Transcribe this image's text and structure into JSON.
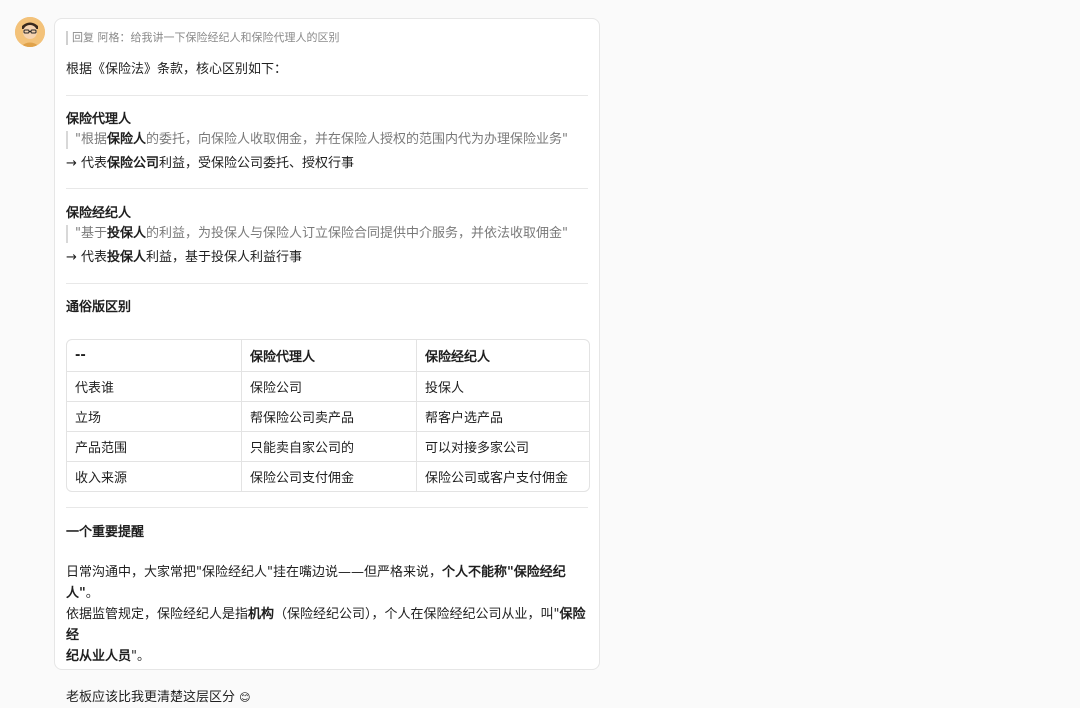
{
  "avatar": {
    "alt": "user-avatar",
    "bg": "#f3c27a"
  },
  "message": {
    "reply_header": "回复 阿格：给我讲一下保险经纪人和保险代理人的区别",
    "intro": "根据《保险法》条款，核心区别如下：",
    "agent": {
      "title": "保险代理人",
      "quote_pre": "\"根据",
      "quote_bold": "保险人",
      "quote_post": "的委托，向保险人收取佣金，并在保险人授权的范围内代为办理保险业务\"",
      "summary_pre": "→ 代表",
      "summary_bold": "保险公司",
      "summary_post": "利益，受保险公司委托、授权行事"
    },
    "broker": {
      "title": "保险经纪人",
      "quote_pre": "\"基于",
      "quote_bold": "投保人",
      "quote_post": "的利益，为投保人与保险人订立保险合同提供中介服务，并依法收取佣金\"",
      "summary_pre": "→ 代表",
      "summary_bold": "投保人",
      "summary_post": "利益，基于投保人利益行事"
    },
    "table_title": "通俗版区别",
    "table": {
      "headers": [
        "--",
        "保险代理人",
        "保险经纪人"
      ],
      "rows": [
        [
          "代表谁",
          "保险公司",
          "投保人"
        ],
        [
          "立场",
          "帮保险公司卖产品",
          "帮客户选产品"
        ],
        [
          "产品范围",
          "只能卖自家公司的",
          "可以对接多家公司"
        ],
        [
          "收入来源",
          "保险公司支付佣金",
          "保险公司或客户支付佣金"
        ]
      ]
    },
    "reminder": {
      "title": "一个重要提醒",
      "p1_a": "日常沟通中，大家常把\"保险经纪人\"挂在嘴边说——但严格来说，",
      "p1_b": "个人不能称\"保险经纪人\"",
      "p1_c": "。",
      "p2_a": "依据监管规定，保险经纪人是指",
      "p2_b": "机构",
      "p2_c": "（保险经纪公司），个人在保险经纪公司从业，叫\"",
      "p2_d": "保险经",
      "p2_e": "纪从业人员",
      "p2_f": "\"。"
    },
    "closing": "老板应该比我更清楚这层区分",
    "closing_emoji": "😊"
  }
}
